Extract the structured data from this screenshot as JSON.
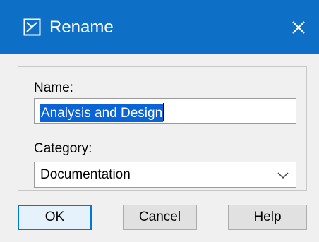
{
  "window": {
    "title": "Rename",
    "icon": "rename-dialog-icon",
    "close_icon": "close-icon",
    "titlebar_color": "#0e6fc7"
  },
  "form": {
    "name_label": "Name:",
    "name_value": "Analysis and Design",
    "category_label": "Category:",
    "category_value": "Documentation"
  },
  "buttons": {
    "ok_label": "OK",
    "cancel_label": "Cancel",
    "help_label": "Help"
  },
  "colors": {
    "selection": "#0a64d6",
    "default_button_border": "#0078d7"
  }
}
